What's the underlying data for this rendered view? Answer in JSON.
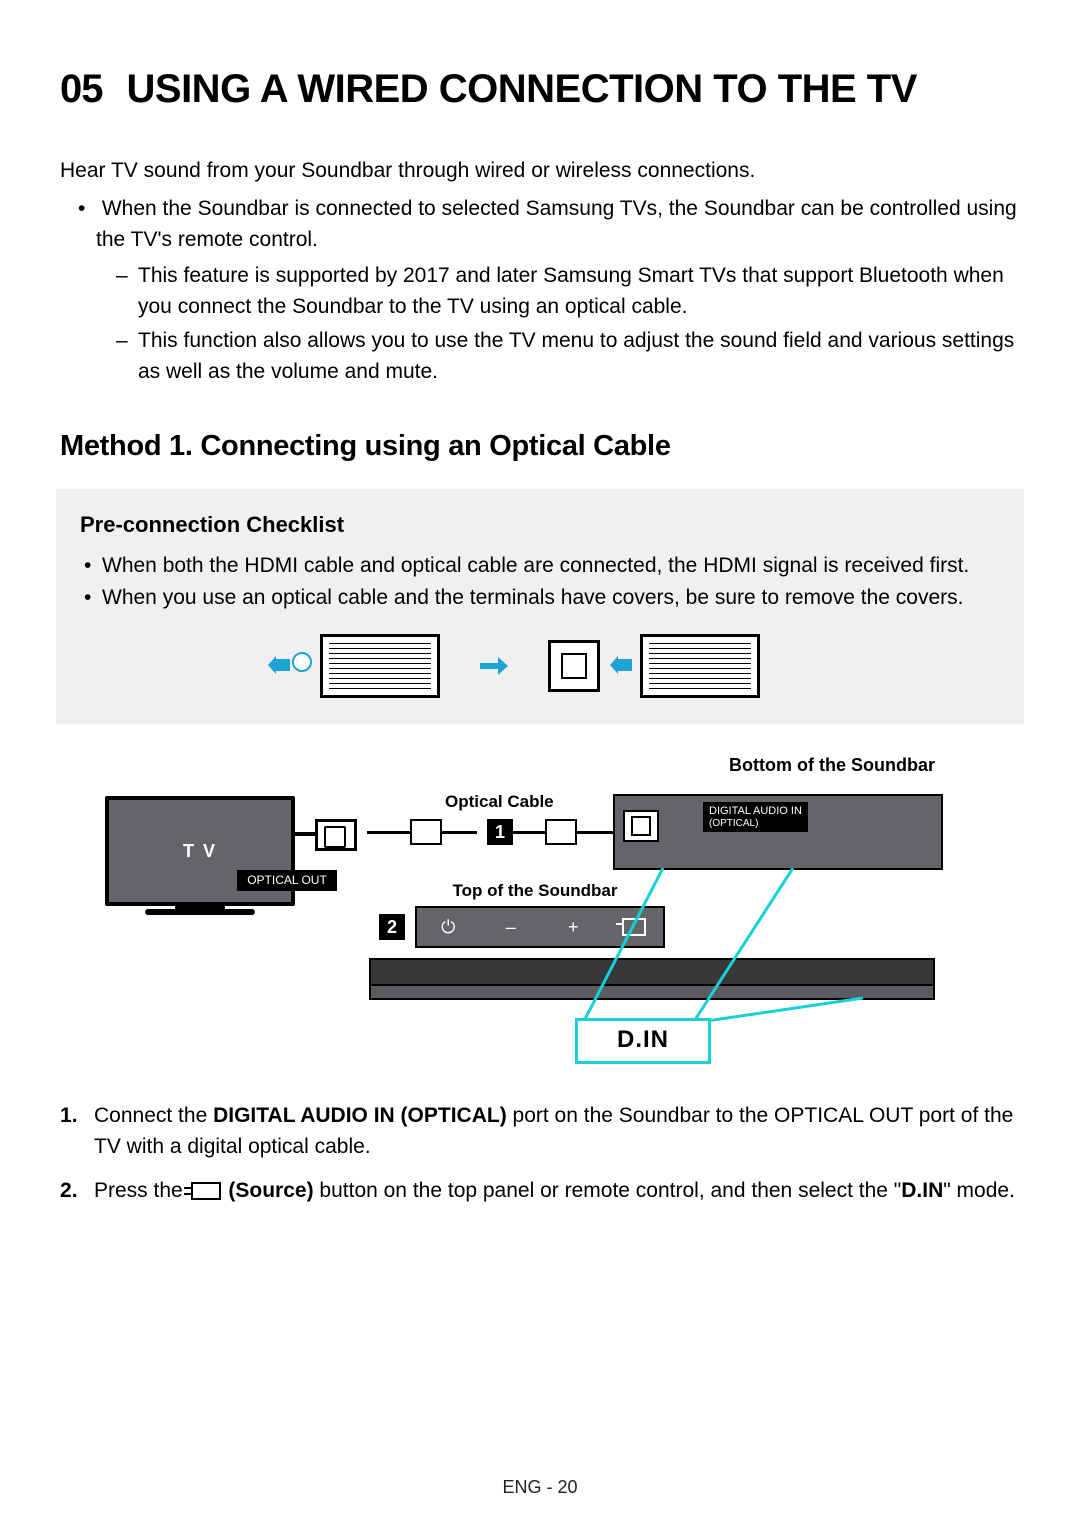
{
  "chapter": {
    "num": "05",
    "title": "USING A WIRED CONNECTION TO THE TV"
  },
  "intro": "Hear TV sound from your Soundbar through wired or wireless connections.",
  "bullet1": "When the Soundbar is connected to selected Samsung TVs, the Soundbar can be controlled using the TV's remote control.",
  "dash1": "This feature is supported by 2017 and later Samsung Smart TVs that support Bluetooth when you connect the Soundbar to the TV using an optical cable.",
  "dash2": "This function also allows you to use the TV menu to adjust the sound field and various settings as well as the volume and mute.",
  "method_heading": "Method 1. Connecting using an Optical Cable",
  "checklist": {
    "heading": "Pre-connection Checklist",
    "item1": "When both the HDMI cable and optical cable are connected, the HDMI signal is received first.",
    "item2": "When you use an optical cable and the terminals have covers, be sure to remove the covers."
  },
  "diagram": {
    "bottom_label": "Bottom of the Soundbar",
    "optical_cable": "Optical Cable",
    "tv_label": "T V",
    "optical_out": "OPTICAL OUT",
    "digital_in_line1": "DIGITAL AUDIO IN",
    "digital_in_line2": "(OPTICAL)",
    "top_label": "Top of the Soundbar",
    "step1": "1",
    "step2": "2",
    "din": "D.IN",
    "power_sym": "⏻",
    "minus": "–",
    "plus": "+"
  },
  "steps": {
    "s1_pre": "Connect the ",
    "s1_bold": "DIGITAL AUDIO IN (OPTICAL)",
    "s1_post": " port on the Soundbar to the OPTICAL OUT port of the TV with a digital optical cable.",
    "s2_pre": "Press the ",
    "s2_bold_source": "(Source)",
    "s2_mid": " button on the top panel or remote control, and then select the \"",
    "s2_bold_din": "D.IN",
    "s2_post": "\" mode."
  },
  "footer": "ENG - 20"
}
